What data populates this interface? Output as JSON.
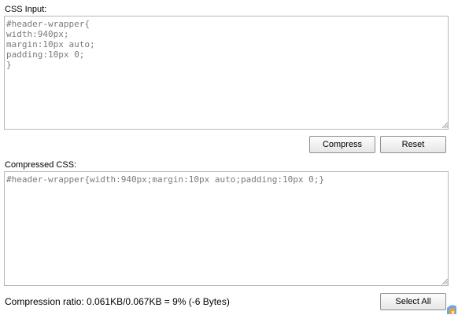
{
  "input_section": {
    "label": "CSS Input:",
    "value": "#header-wrapper{\nwidth:940px;\nmargin:10px auto;\npadding:10px 0;\n}"
  },
  "actions": {
    "compress_label": "Compress",
    "reset_label": "Reset"
  },
  "output_section": {
    "label": "Compressed CSS:",
    "value": "#header-wrapper{width:940px;margin:10px auto;padding:10px 0;}"
  },
  "footer": {
    "ratio_text": "Compression ratio: 0.061KB/0.067KB = 9% (-6 Bytes)",
    "select_all_label": "Select All"
  },
  "icons": {
    "resize_grip": "resize-grip-icon",
    "corner_logo": "app-logo-icon"
  },
  "colors": {
    "border": "#b7b7b7",
    "code_text": "#7a7a7a",
    "button_border": "#8f8f8f"
  }
}
